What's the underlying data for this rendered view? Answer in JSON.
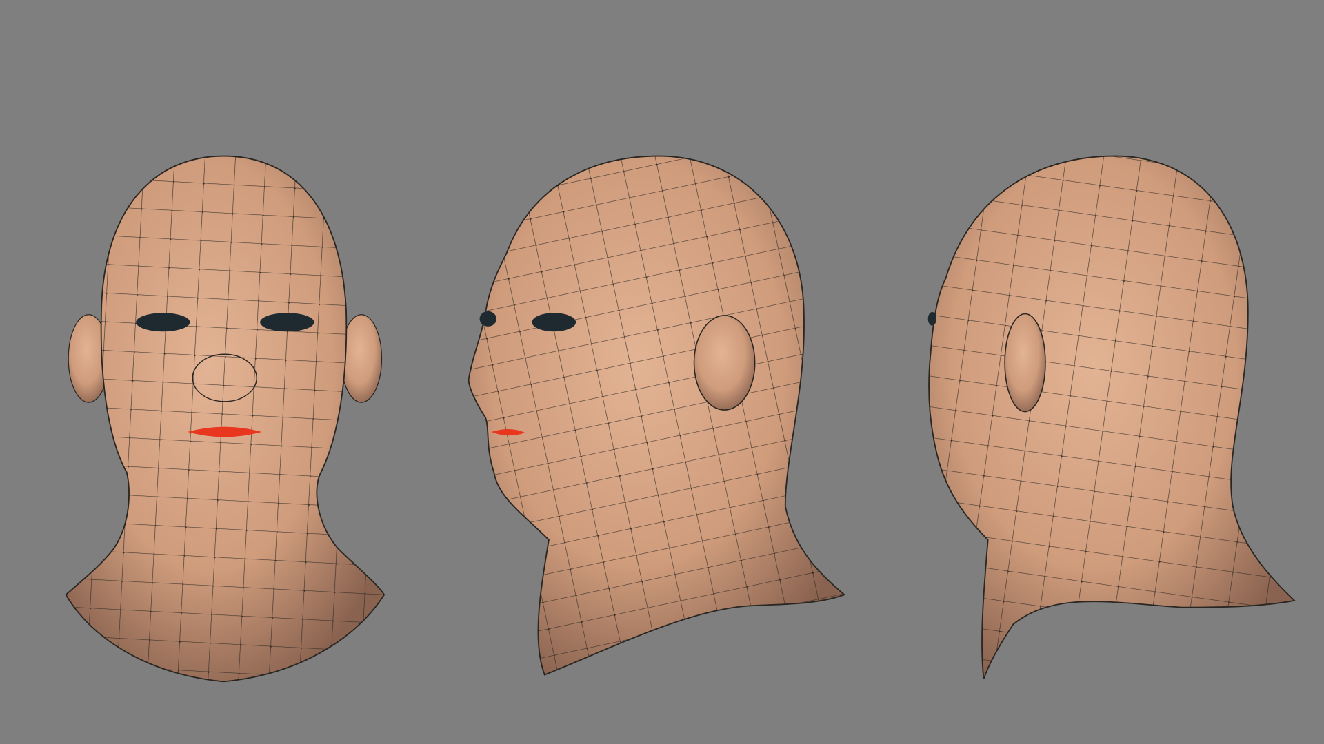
{
  "scene": {
    "background_color": "#7f7f7f",
    "skin_color": "#d9a687",
    "wire_color": "#2a2622",
    "eye_color": "#1f2a30",
    "lip_color": "#e8361f",
    "views": [
      {
        "name": "front"
      },
      {
        "name": "three-quarter"
      },
      {
        "name": "back-three-quarter"
      }
    ]
  }
}
